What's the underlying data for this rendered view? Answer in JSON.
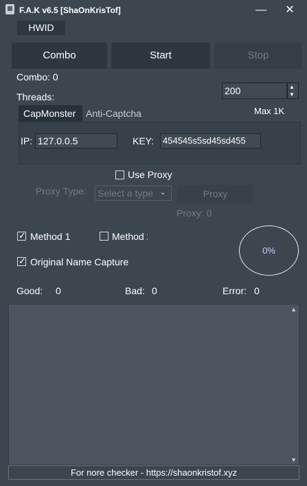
{
  "window": {
    "title": "F.A.K v6.5 [ShaOnKrisTof]",
    "minimize": "—",
    "close": "✕"
  },
  "hwid_button": "HWID",
  "toolbar": {
    "combo": "Combo",
    "start": "Start",
    "stop": "Stop"
  },
  "combo_count": "Combo: 0",
  "threads": {
    "label": "Threads:",
    "value": "200",
    "max": "Max 1K"
  },
  "captcha_tabs": [
    "CapMonster",
    "Anti-Captcha"
  ],
  "captcha": {
    "ip_label": "IP:",
    "ip_value": "127.0.0.5",
    "key_label": "KEY:",
    "key_value": "454545s5sd45sd455"
  },
  "proxy": {
    "use_label": "Use Proxy",
    "use_checked": false,
    "type_label": "Proxy Type:",
    "type_placeholder": "Select a type",
    "button": "Proxy",
    "count": "Proxy: 0"
  },
  "methods": [
    {
      "label": "Method 1",
      "checked": true
    },
    {
      "label": "Method 2",
      "checked": false
    }
  ],
  "original_name_capture": {
    "label": "Original Name Capture",
    "checked": true
  },
  "progress": {
    "label": "0%",
    "value": 0
  },
  "stats": {
    "good_label": "Good:",
    "good": "0",
    "bad_label": "Bad:",
    "bad": "0",
    "error_label": "Error:",
    "error": "0"
  },
  "footer": "For nore checker - https://shaonkristof.xyz",
  "colors": {
    "background": "#3b464f",
    "button": "#2d3740",
    "output": "#4b5660",
    "disabled_text": "#737b82"
  }
}
